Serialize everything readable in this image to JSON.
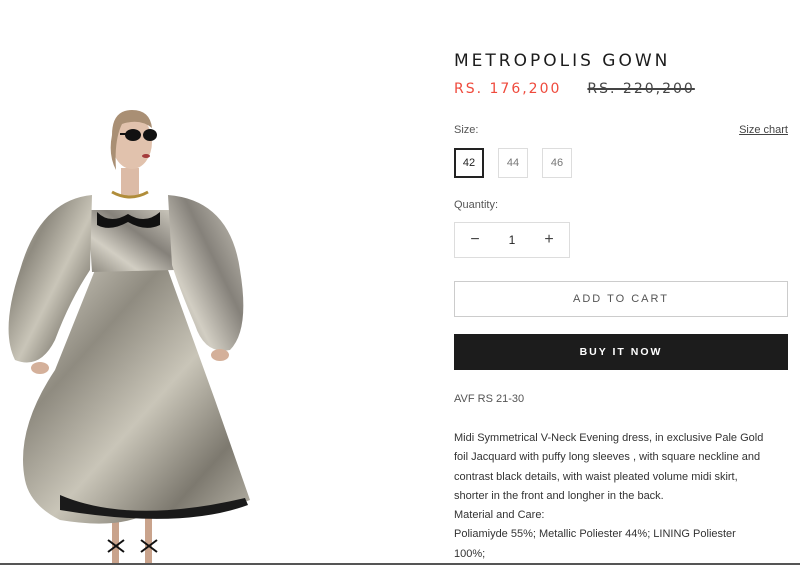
{
  "product": {
    "title": "METROPOLIS GOWN",
    "sale_price": "RS. 176,200",
    "compare_price": "RS. 220,200"
  },
  "size": {
    "label": "Size:",
    "chart_link": "Size chart",
    "options": [
      "42",
      "44",
      "46"
    ],
    "selected": "42"
  },
  "quantity": {
    "label": "Quantity:",
    "value": "1",
    "decrement_glyph": "−",
    "increment_glyph": "+"
  },
  "actions": {
    "add_to_cart": "ADD TO CART",
    "buy_now": "BUY IT NOW"
  },
  "avf": "AVF RS 21-30",
  "description": {
    "lines": [
      "Midi Symmetrical V-Neck Evening dress, in exclusive Pale Gold",
      "foil Jacquard with puffy long sleeves , with square neckline and",
      "contrast black details, with waist pleated volume midi skirt,",
      "shorter in the front and longher in the back.",
      "Material and Care:",
      "Poliamiyde 55%; Metallic Poliester 44%; LINING Poliester",
      "100%;"
    ]
  },
  "colors": {
    "sale_price": "#ef4a3c",
    "buy_button_bg": "#1c1c1c",
    "gown_gold": "#a9a59a"
  }
}
